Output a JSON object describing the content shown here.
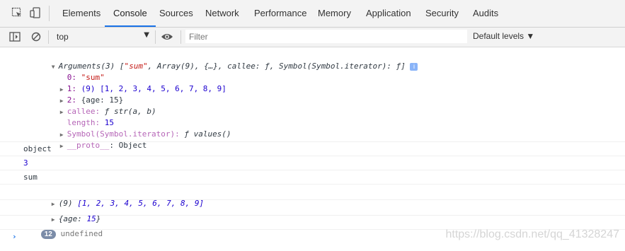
{
  "toolbar": {
    "tabs": [
      "Elements",
      "Console",
      "Sources",
      "Network",
      "Performance",
      "Memory",
      "Application",
      "Security",
      "Audits"
    ],
    "active_tab": "Console"
  },
  "filterbar": {
    "context": "top",
    "filter_placeholder": "Filter",
    "levels_label": "Default levels ▼"
  },
  "console": {
    "arguments_summary": {
      "prefix": "Arguments(3) [",
      "first": "\"sum\"",
      "rest": ", Array(9), {…}, callee: ƒ, Symbol(Symbol.iterator): ƒ]"
    },
    "props": {
      "p0_key": "0: ",
      "p0_val": "\"sum\"",
      "p1_key": "1: ",
      "p1_val": "(9) [1, 2, 3, 4, 5, 6, 7, 8, 9]",
      "p2_key": "2: ",
      "p2_val": "{age: 15}",
      "callee_key": "callee: ",
      "callee_val": "ƒ str(a, b)",
      "length_key": "length: ",
      "length_val": "15",
      "symbol_key": "Symbol(Symbol.iterator): ",
      "symbol_val": "ƒ values()",
      "proto_key": "__proto__",
      "proto_val": ": Object"
    },
    "output_object": "object",
    "output_3": "3",
    "output_sum": "sum",
    "array_prefix": "(9) ",
    "array_values": "[1, 2, 3, 4, 5, 6, 7, 8, 9]",
    "obj_prefix": "{age: ",
    "obj_value": "15",
    "obj_suffix": "}",
    "repeat_count": "12",
    "undefined_text": "undefined",
    "prompt": "›"
  },
  "watermark": "https://blog.csdn.net/qq_41328247"
}
